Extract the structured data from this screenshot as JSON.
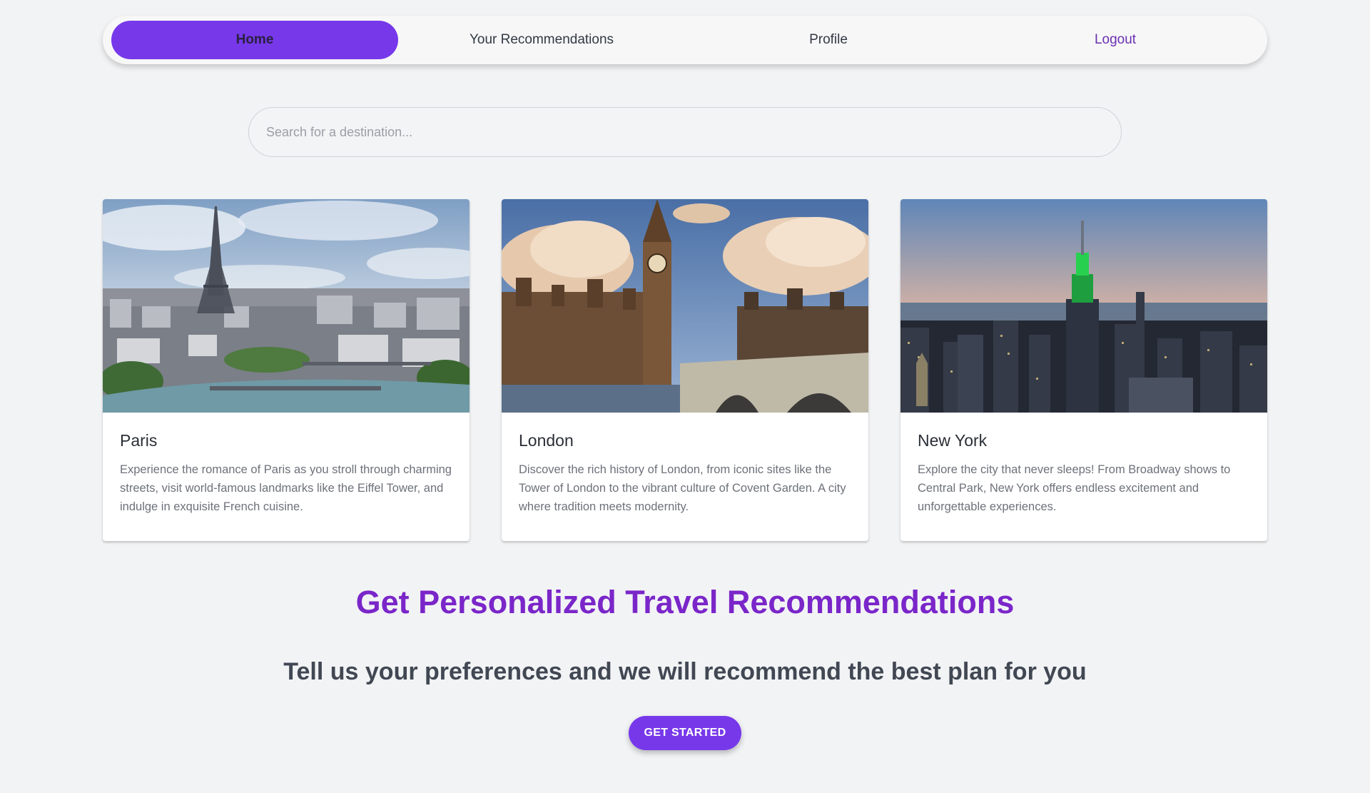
{
  "nav": {
    "items": [
      {
        "label": "Home",
        "active": true
      },
      {
        "label": "Your Recommendations",
        "active": false
      },
      {
        "label": "Profile",
        "active": false
      },
      {
        "label": "Logout",
        "active": false
      }
    ]
  },
  "search": {
    "placeholder": "Search for a destination...",
    "value": ""
  },
  "cards": [
    {
      "title": "Paris",
      "description": "Experience the romance of Paris as you stroll through charming streets, visit world-famous landmarks like the Eiffel Tower, and indulge in exquisite French cuisine.",
      "image": "paris-eiffel-tower-photo"
    },
    {
      "title": "London",
      "description": "Discover the rich history of London, from iconic sites like the Tower of London to the vibrant culture of Covent Garden. A city where tradition meets modernity.",
      "image": "london-big-ben-photo"
    },
    {
      "title": "New York",
      "description": "Explore the city that never sleeps! From Broadway shows to Central Park, New York offers endless excitement and unforgettable experiences.",
      "image": "new-york-skyline-photo"
    }
  ],
  "cta": {
    "title": "Get Personalized Travel Recommendations",
    "subtitle": "Tell us your preferences and we will recommend the best plan for you",
    "button_label": "GET STARTED"
  },
  "colors": {
    "accent": "#7738ea",
    "heading_purple": "#7a26c9",
    "background": "#f2f3f5"
  }
}
